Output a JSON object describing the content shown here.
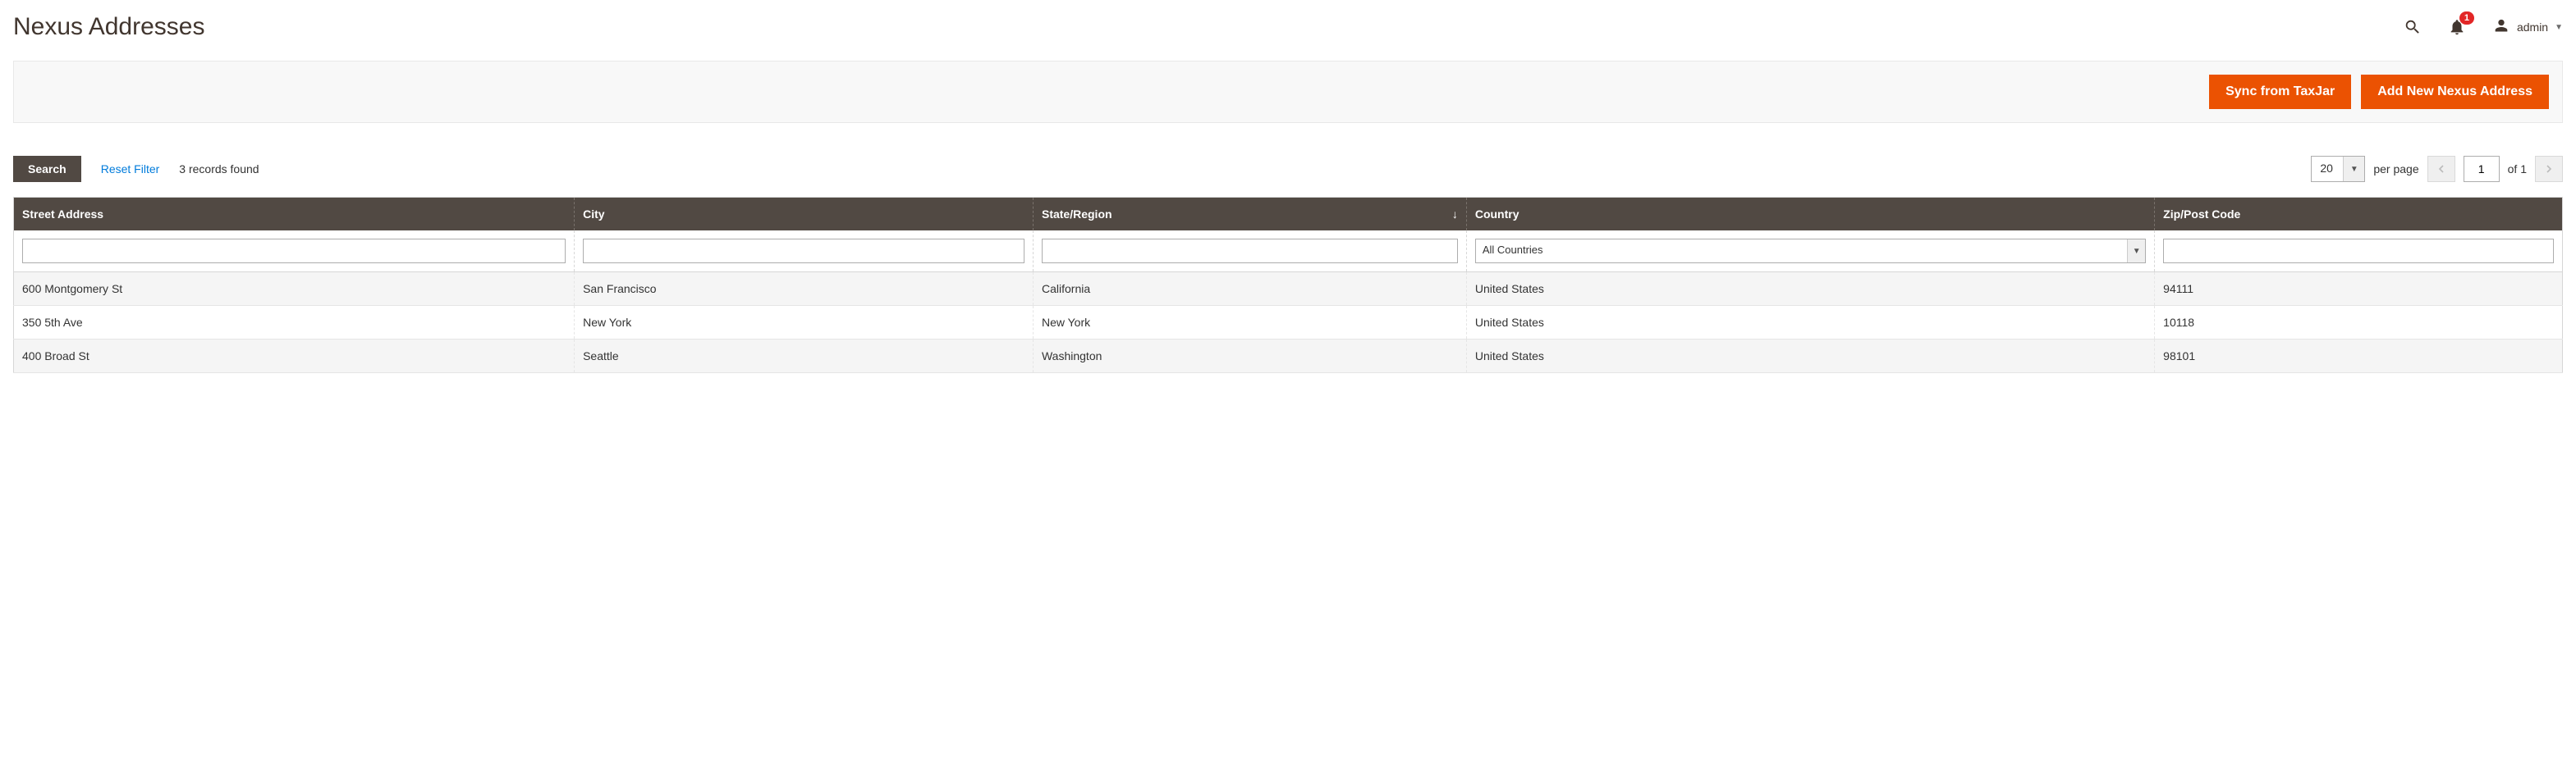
{
  "header": {
    "title": "Nexus Addresses",
    "notification_count": "1",
    "user_label": "admin"
  },
  "action_bar": {
    "sync_label": "Sync from TaxJar",
    "add_label": "Add New Nexus Address"
  },
  "grid_controls": {
    "search_label": "Search",
    "reset_label": "Reset Filter",
    "records_found": "3 records found",
    "per_page_value": "20",
    "per_page_label": "per page",
    "page_current": "1",
    "page_of_label": "of 1"
  },
  "table": {
    "columns": {
      "street": "Street Address",
      "city": "City",
      "state": "State/Region",
      "country": "Country",
      "zip": "Zip/Post Code"
    },
    "country_filter_selected": "All Countries",
    "rows": [
      {
        "street": "600 Montgomery St",
        "city": "San Francisco",
        "state": "California",
        "country": "United States",
        "zip": "94111"
      },
      {
        "street": "350 5th Ave",
        "city": "New York",
        "state": "New York",
        "country": "United States",
        "zip": "10118"
      },
      {
        "street": "400 Broad St",
        "city": "Seattle",
        "state": "Washington",
        "country": "United States",
        "zip": "98101"
      }
    ]
  }
}
